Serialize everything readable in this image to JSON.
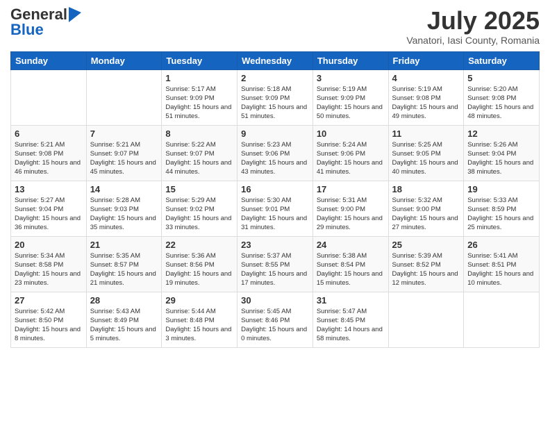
{
  "logo": {
    "general": "General",
    "blue": "Blue"
  },
  "header": {
    "month": "July 2025",
    "location": "Vanatori, Iasi County, Romania"
  },
  "weekdays": [
    "Sunday",
    "Monday",
    "Tuesday",
    "Wednesday",
    "Thursday",
    "Friday",
    "Saturday"
  ],
  "weeks": [
    [
      {
        "day": "",
        "info": ""
      },
      {
        "day": "",
        "info": ""
      },
      {
        "day": "1",
        "info": "Sunrise: 5:17 AM\nSunset: 9:09 PM\nDaylight: 15 hours and 51 minutes."
      },
      {
        "day": "2",
        "info": "Sunrise: 5:18 AM\nSunset: 9:09 PM\nDaylight: 15 hours and 51 minutes."
      },
      {
        "day": "3",
        "info": "Sunrise: 5:19 AM\nSunset: 9:09 PM\nDaylight: 15 hours and 50 minutes."
      },
      {
        "day": "4",
        "info": "Sunrise: 5:19 AM\nSunset: 9:08 PM\nDaylight: 15 hours and 49 minutes."
      },
      {
        "day": "5",
        "info": "Sunrise: 5:20 AM\nSunset: 9:08 PM\nDaylight: 15 hours and 48 minutes."
      }
    ],
    [
      {
        "day": "6",
        "info": "Sunrise: 5:21 AM\nSunset: 9:08 PM\nDaylight: 15 hours and 46 minutes."
      },
      {
        "day": "7",
        "info": "Sunrise: 5:21 AM\nSunset: 9:07 PM\nDaylight: 15 hours and 45 minutes."
      },
      {
        "day": "8",
        "info": "Sunrise: 5:22 AM\nSunset: 9:07 PM\nDaylight: 15 hours and 44 minutes."
      },
      {
        "day": "9",
        "info": "Sunrise: 5:23 AM\nSunset: 9:06 PM\nDaylight: 15 hours and 43 minutes."
      },
      {
        "day": "10",
        "info": "Sunrise: 5:24 AM\nSunset: 9:06 PM\nDaylight: 15 hours and 41 minutes."
      },
      {
        "day": "11",
        "info": "Sunrise: 5:25 AM\nSunset: 9:05 PM\nDaylight: 15 hours and 40 minutes."
      },
      {
        "day": "12",
        "info": "Sunrise: 5:26 AM\nSunset: 9:04 PM\nDaylight: 15 hours and 38 minutes."
      }
    ],
    [
      {
        "day": "13",
        "info": "Sunrise: 5:27 AM\nSunset: 9:04 PM\nDaylight: 15 hours and 36 minutes."
      },
      {
        "day": "14",
        "info": "Sunrise: 5:28 AM\nSunset: 9:03 PM\nDaylight: 15 hours and 35 minutes."
      },
      {
        "day": "15",
        "info": "Sunrise: 5:29 AM\nSunset: 9:02 PM\nDaylight: 15 hours and 33 minutes."
      },
      {
        "day": "16",
        "info": "Sunrise: 5:30 AM\nSunset: 9:01 PM\nDaylight: 15 hours and 31 minutes."
      },
      {
        "day": "17",
        "info": "Sunrise: 5:31 AM\nSunset: 9:00 PM\nDaylight: 15 hours and 29 minutes."
      },
      {
        "day": "18",
        "info": "Sunrise: 5:32 AM\nSunset: 9:00 PM\nDaylight: 15 hours and 27 minutes."
      },
      {
        "day": "19",
        "info": "Sunrise: 5:33 AM\nSunset: 8:59 PM\nDaylight: 15 hours and 25 minutes."
      }
    ],
    [
      {
        "day": "20",
        "info": "Sunrise: 5:34 AM\nSunset: 8:58 PM\nDaylight: 15 hours and 23 minutes."
      },
      {
        "day": "21",
        "info": "Sunrise: 5:35 AM\nSunset: 8:57 PM\nDaylight: 15 hours and 21 minutes."
      },
      {
        "day": "22",
        "info": "Sunrise: 5:36 AM\nSunset: 8:56 PM\nDaylight: 15 hours and 19 minutes."
      },
      {
        "day": "23",
        "info": "Sunrise: 5:37 AM\nSunset: 8:55 PM\nDaylight: 15 hours and 17 minutes."
      },
      {
        "day": "24",
        "info": "Sunrise: 5:38 AM\nSunset: 8:54 PM\nDaylight: 15 hours and 15 minutes."
      },
      {
        "day": "25",
        "info": "Sunrise: 5:39 AM\nSunset: 8:52 PM\nDaylight: 15 hours and 12 minutes."
      },
      {
        "day": "26",
        "info": "Sunrise: 5:41 AM\nSunset: 8:51 PM\nDaylight: 15 hours and 10 minutes."
      }
    ],
    [
      {
        "day": "27",
        "info": "Sunrise: 5:42 AM\nSunset: 8:50 PM\nDaylight: 15 hours and 8 minutes."
      },
      {
        "day": "28",
        "info": "Sunrise: 5:43 AM\nSunset: 8:49 PM\nDaylight: 15 hours and 5 minutes."
      },
      {
        "day": "29",
        "info": "Sunrise: 5:44 AM\nSunset: 8:48 PM\nDaylight: 15 hours and 3 minutes."
      },
      {
        "day": "30",
        "info": "Sunrise: 5:45 AM\nSunset: 8:46 PM\nDaylight: 15 hours and 0 minutes."
      },
      {
        "day": "31",
        "info": "Sunrise: 5:47 AM\nSunset: 8:45 PM\nDaylight: 14 hours and 58 minutes."
      },
      {
        "day": "",
        "info": ""
      },
      {
        "day": "",
        "info": ""
      }
    ]
  ]
}
